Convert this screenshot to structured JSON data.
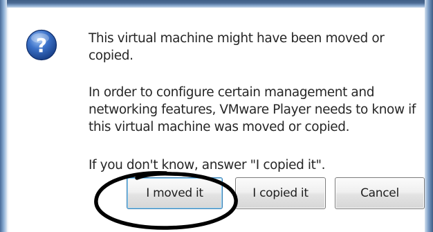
{
  "dialog": {
    "icon": "question-icon",
    "message": {
      "line1": "This virtual machine might have been moved or copied.",
      "line2": "In order to configure certain management and networking features, VMware Player needs to know if this virtual machine was moved or copied.",
      "line3": "If you don't know, answer \"I copied it\"."
    },
    "buttons": {
      "moved": "I moved it",
      "copied": "I copied it",
      "cancel": "Cancel"
    },
    "annotation": "hand-drawn-circle-around-moved-button"
  },
  "colors": {
    "icon_blue": "#2f63b8",
    "window_frame": "#4c6a93",
    "focus_border": "#3c7fb1"
  }
}
